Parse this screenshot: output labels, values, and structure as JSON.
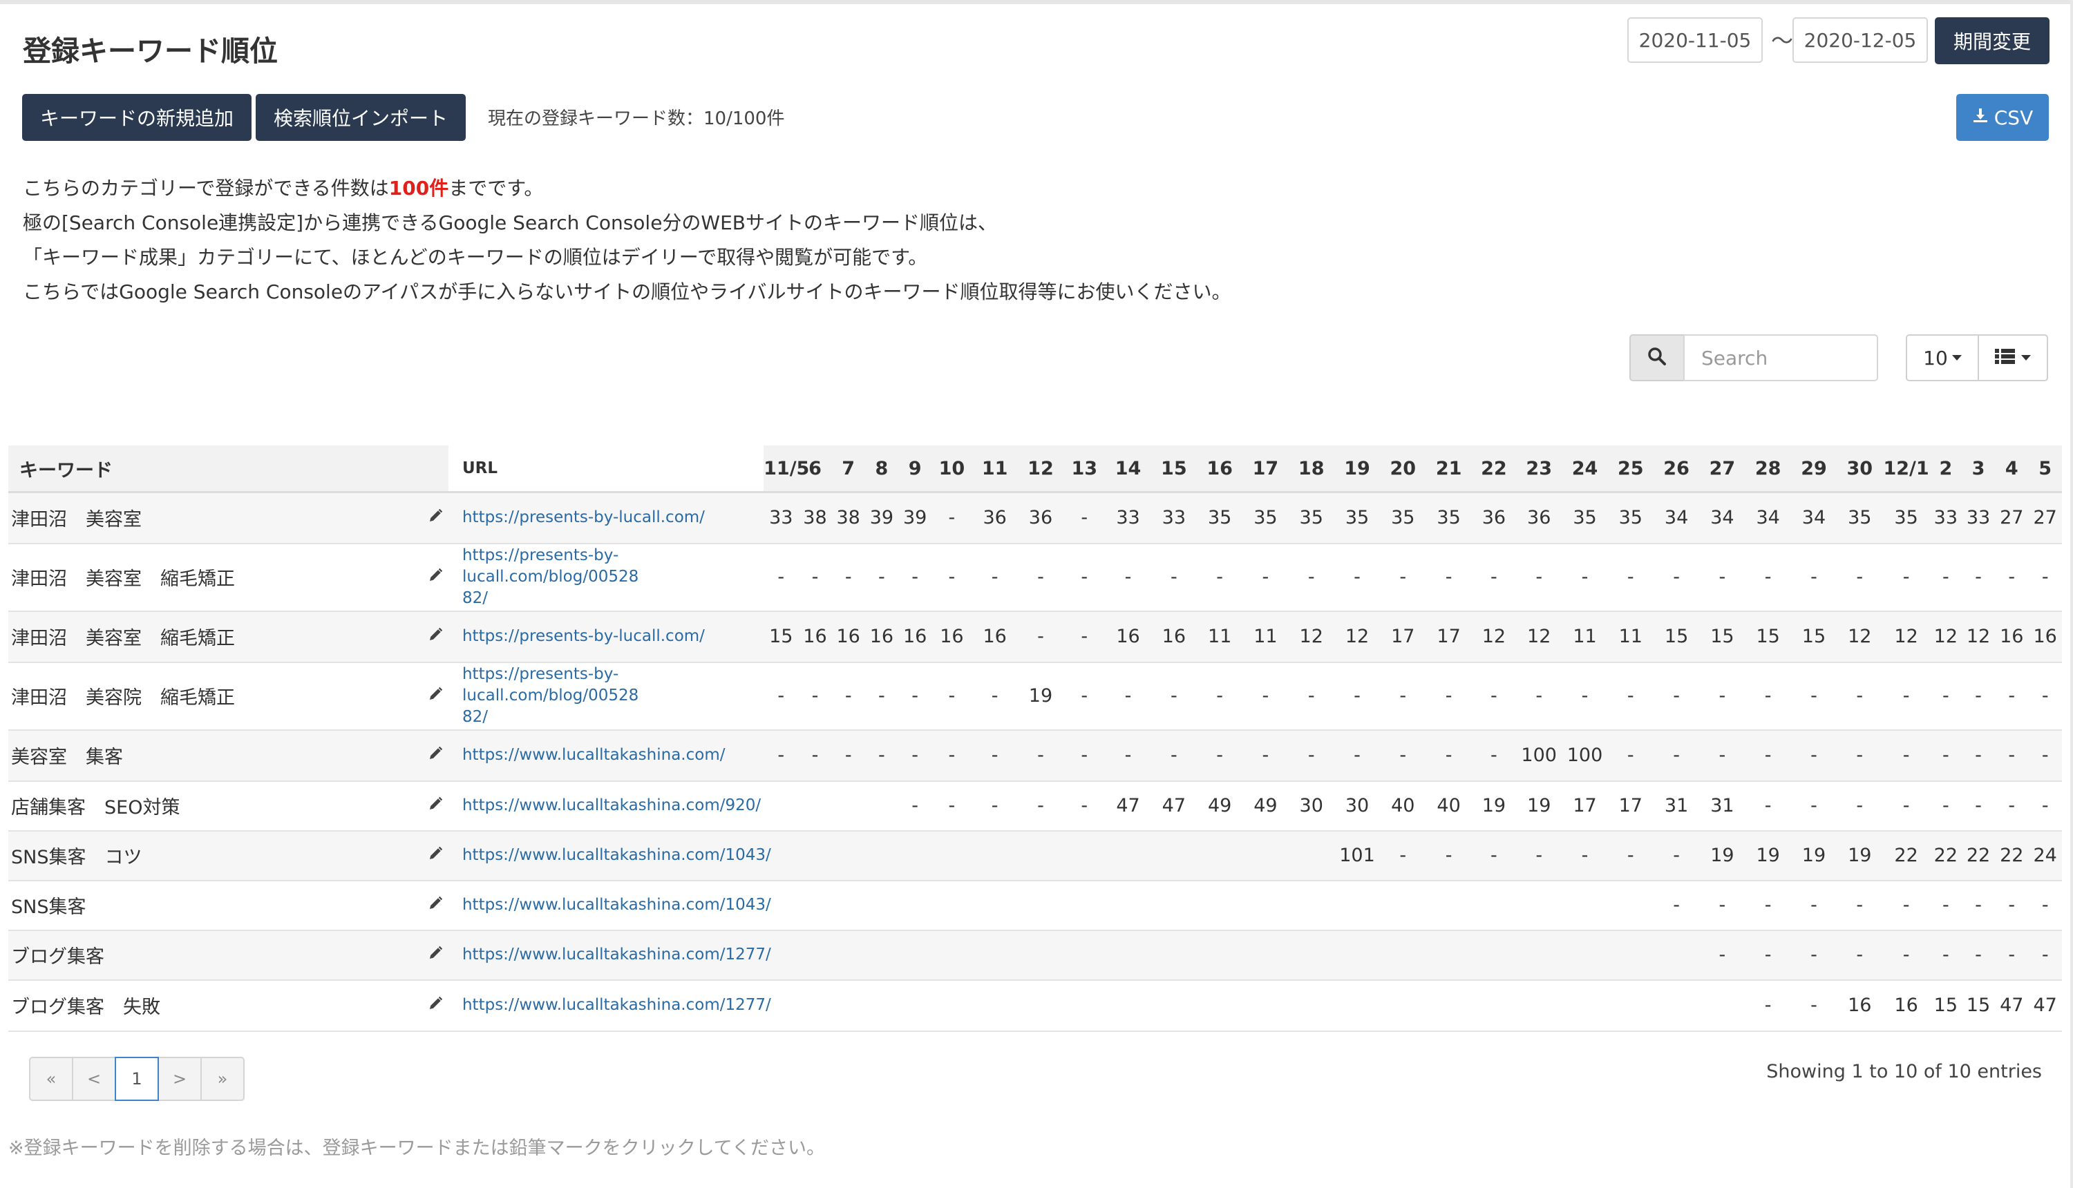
{
  "header": {
    "title": "登録キーワード順位",
    "date_from": "2020-11-05",
    "tilde": "〜",
    "date_to": "2020-12-05",
    "period_button": "期間変更"
  },
  "toolbar": {
    "add_keyword": "キーワードの新規追加",
    "import_rank": "検索順位インポート",
    "keyword_count": "現在の登録キーワード数：10/100件",
    "csv": "CSV"
  },
  "description": {
    "line1_pre": "こちらのカテゴリーで登録ができる件数は",
    "line1_red": "100件",
    "line1_post": "までです。",
    "line2": "極の[Search Console連携設定]から連携できるGoogle Search Console分のWEBサイトのキーワード順位は、",
    "line3": "「キーワード成果」カテゴリーにて、ほとんどのキーワードの順位はデイリーで取得や閲覧が可能です。",
    "line4": "こちらではGoogle Search Consoleのアイパスが手に入らないサイトの順位やライバルサイトのキーワード順位取得等にお使いください。"
  },
  "search": {
    "placeholder": "Search"
  },
  "page_size": "10",
  "table": {
    "headers": {
      "keyword": "キーワード",
      "url": "URL"
    },
    "dates": [
      "11/5",
      "6",
      "7",
      "8",
      "9",
      "10",
      "11",
      "12",
      "13",
      "14",
      "15",
      "16",
      "17",
      "18",
      "19",
      "20",
      "21",
      "22",
      "23",
      "24",
      "25",
      "26",
      "27",
      "28",
      "29",
      "30",
      "12/1",
      "2",
      "3",
      "4",
      "5"
    ],
    "rows": [
      {
        "keyword": "津田沼　美容室",
        "url": [
          "https://presents-by-lucall.com/"
        ],
        "ranks": [
          "33",
          "38",
          "38",
          "39",
          "39",
          "-",
          "36",
          "36",
          "-",
          "33",
          "33",
          "35",
          "35",
          "35",
          "35",
          "35",
          "35",
          "36",
          "36",
          "35",
          "35",
          "34",
          "34",
          "34",
          "34",
          "35",
          "35",
          "33",
          "33",
          "27",
          "27"
        ]
      },
      {
        "keyword": "津田沼　美容室　縮毛矯正",
        "url": [
          "https://presents-by-lucall.com/blog/00528",
          "82/"
        ],
        "ranks": [
          "-",
          "-",
          "-",
          "-",
          "-",
          "-",
          "-",
          "-",
          "-",
          "-",
          "-",
          "-",
          "-",
          "-",
          "-",
          "-",
          "-",
          "-",
          "-",
          "-",
          "-",
          "-",
          "-",
          "-",
          "-",
          "-",
          "-",
          "-",
          "-",
          "-",
          "-"
        ]
      },
      {
        "keyword": "津田沼　美容室　縮毛矯正",
        "url": [
          "https://presents-by-lucall.com/"
        ],
        "ranks": [
          "15",
          "16",
          "16",
          "16",
          "16",
          "16",
          "16",
          "-",
          "-",
          "16",
          "16",
          "11",
          "11",
          "12",
          "12",
          "17",
          "17",
          "12",
          "12",
          "11",
          "11",
          "15",
          "15",
          "15",
          "15",
          "12",
          "12",
          "12",
          "12",
          "16",
          "16"
        ]
      },
      {
        "keyword": "津田沼　美容院　縮毛矯正",
        "url": [
          "https://presents-by-lucall.com/blog/00528",
          "82/"
        ],
        "ranks": [
          "-",
          "-",
          "-",
          "-",
          "-",
          "-",
          "-",
          "19",
          "-",
          "-",
          "-",
          "-",
          "-",
          "-",
          "-",
          "-",
          "-",
          "-",
          "-",
          "-",
          "-",
          "-",
          "-",
          "-",
          "-",
          "-",
          "-",
          "-",
          "-",
          "-",
          "-"
        ]
      },
      {
        "keyword": "美容室　集客",
        "url": [
          "https://www.lucalltakashina.com/"
        ],
        "ranks": [
          "-",
          "-",
          "-",
          "-",
          "-",
          "-",
          "-",
          "-",
          "-",
          "-",
          "-",
          "-",
          "-",
          "-",
          "-",
          "-",
          "-",
          "-",
          "100",
          "100",
          "-",
          "-",
          "-",
          "-",
          "-",
          "-",
          "-",
          "-",
          "-",
          "-",
          "-"
        ]
      },
      {
        "keyword": "店舗集客　SEO対策",
        "url": [
          "https://www.lucalltakashina.com/920/"
        ],
        "ranks": [
          "",
          "",
          "",
          "",
          "-",
          "-",
          "-",
          "-",
          "-",
          "47",
          "47",
          "49",
          "49",
          "30",
          "30",
          "40",
          "40",
          "19",
          "19",
          "17",
          "17",
          "31",
          "31",
          "-",
          "-",
          "-",
          "-",
          "-",
          "-",
          "-",
          "-"
        ]
      },
      {
        "keyword": "SNS集客　コツ",
        "url": [
          "https://www.lucalltakashina.com/1043/"
        ],
        "ranks": [
          "",
          "",
          "",
          "",
          "",
          "",
          "",
          "",
          "",
          "",
          "",
          "",
          "",
          "",
          "101",
          "-",
          "-",
          "-",
          "-",
          "-",
          "-",
          "-",
          "19",
          "19",
          "19",
          "19",
          "22",
          "22",
          "22",
          "22",
          "24"
        ]
      },
      {
        "keyword": "SNS集客",
        "url": [
          "https://www.lucalltakashina.com/1043/"
        ],
        "ranks": [
          "",
          "",
          "",
          "",
          "",
          "",
          "",
          "",
          "",
          "",
          "",
          "",
          "",
          "",
          "",
          "",
          "",
          "",
          "",
          "",
          "",
          "-",
          "-",
          "-",
          "-",
          "-",
          "-",
          "-",
          "-",
          "-",
          "-"
        ]
      },
      {
        "keyword": "ブログ集客",
        "url": [
          "https://www.lucalltakashina.com/1277/"
        ],
        "ranks": [
          "",
          "",
          "",
          "",
          "",
          "",
          "",
          "",
          "",
          "",
          "",
          "",
          "",
          "",
          "",
          "",
          "",
          "",
          "",
          "",
          "",
          "",
          "-",
          "-",
          "-",
          "-",
          "-",
          "-",
          "-",
          "-",
          "-"
        ]
      },
      {
        "keyword": "ブログ集客　失敗",
        "url": [
          "https://www.lucalltakashina.com/1277/"
        ],
        "ranks": [
          "",
          "",
          "",
          "",
          "",
          "",
          "",
          "",
          "",
          "",
          "",
          "",
          "",
          "",
          "",
          "",
          "",
          "",
          "",
          "",
          "",
          "",
          "",
          "-",
          "-",
          "16",
          "16",
          "15",
          "15",
          "47",
          "47"
        ]
      }
    ]
  },
  "pagination": {
    "first": "«",
    "prev": "<",
    "current": "1",
    "next": ">",
    "last": "»"
  },
  "showing": "Showing 1 to 10 of 10 entries",
  "note": "※登録キーワードを削除する場合は、登録キーワードまたは鉛筆マークをクリックしてください。",
  "colors": {
    "dark_button": "#2b3a50",
    "csv_button": "#3f83c8",
    "highlight": "#e0201b",
    "link": "#2a6aa5"
  },
  "icons": {
    "pencil": "pencil-icon",
    "search": "search-icon",
    "download": "download-icon",
    "columns": "list-icon"
  }
}
